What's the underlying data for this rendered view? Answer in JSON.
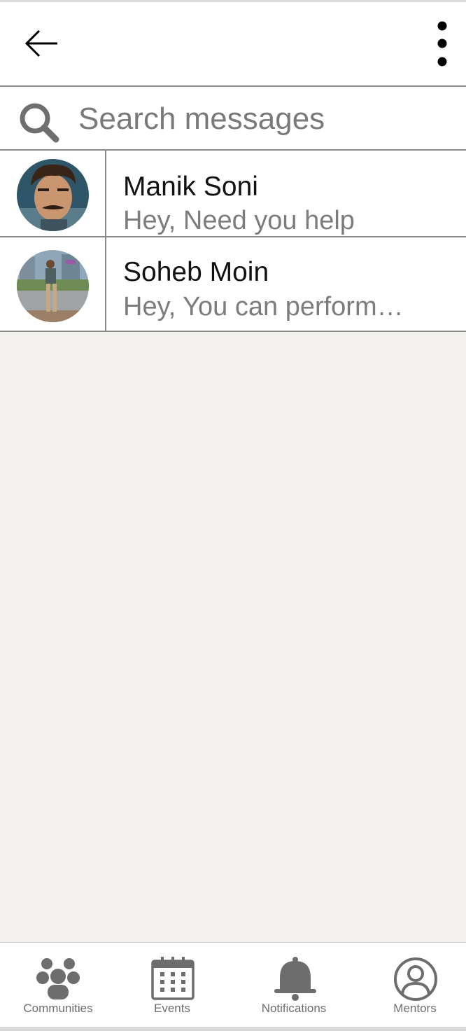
{
  "header": {
    "back_icon": "arrow-left-icon",
    "more_icon": "more-vertical-icon"
  },
  "search": {
    "icon": "search-icon",
    "placeholder": "Search messages",
    "value": ""
  },
  "conversations": [
    {
      "name": "Manik Soni",
      "preview": "Hey, Need you help"
    },
    {
      "name": "Soheb Moin",
      "preview": "Hey, You can perform…"
    }
  ],
  "bottom_nav": [
    {
      "label": "Communities",
      "icon": "communities-icon"
    },
    {
      "label": "Events",
      "icon": "calendar-icon"
    },
    {
      "label": "Notifications",
      "icon": "bell-icon"
    },
    {
      "label": "Mentors",
      "icon": "user-circle-icon"
    }
  ],
  "colors": {
    "background": "#f2f1ee",
    "divider": "#8a8a8a",
    "icon_gray": "#6d6d6d"
  }
}
